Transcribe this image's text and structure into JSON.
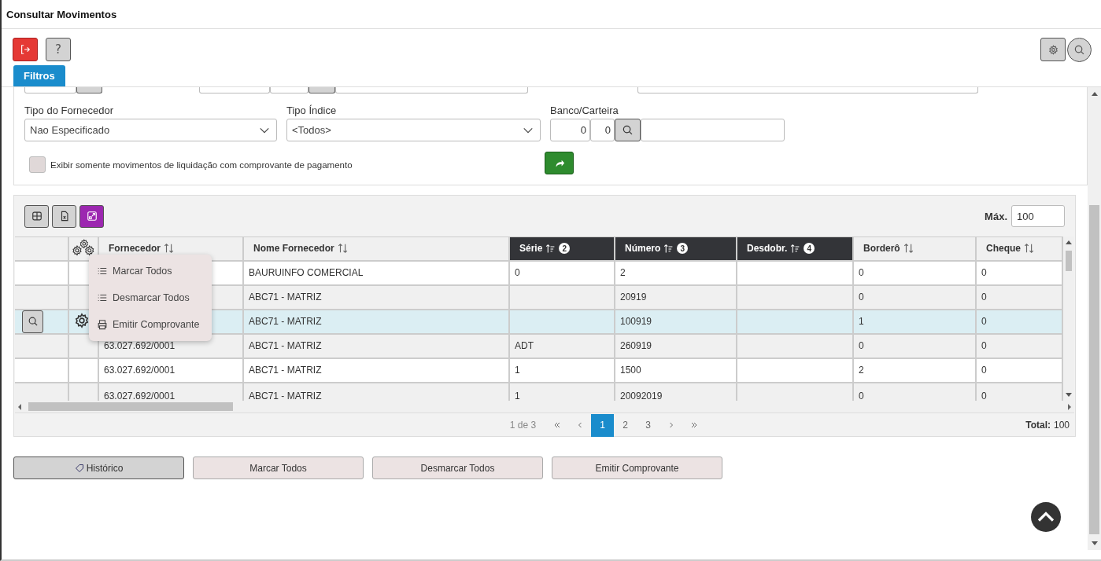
{
  "window": {
    "title": "Consultar Movimentos"
  },
  "toolbar": {
    "left": [
      {
        "kind": "exit"
      },
      {
        "kind": "help",
        "label": "?"
      }
    ],
    "right": [
      {
        "kind": "settings"
      },
      {
        "kind": "search"
      }
    ]
  },
  "tabs": [
    {
      "label": "Filtros",
      "selected": true
    }
  ],
  "filters": {
    "fields": [
      {
        "label": "Tipo do Fornecedor",
        "value": "Nao Especificado",
        "kind": "select"
      },
      {
        "label": "Tipo Índice",
        "value": "<Todos>",
        "kind": "select"
      }
    ],
    "bank": {
      "label": "Banco/Carteira",
      "bank": "0",
      "wallet": "0"
    },
    "checkbox": {
      "label": "Exibir somente movimentos de liquidação com comprovante de pagamento",
      "checked": false
    }
  },
  "grid": {
    "max_label": "Máx.",
    "max_value": "100",
    "columns": [
      {
        "label": "Fornecedor",
        "sorted": false
      },
      {
        "label": "Nome Fornecedor",
        "sorted": false
      },
      {
        "label": "Série",
        "sorted": true,
        "order": "2"
      },
      {
        "label": "Número",
        "sorted": true,
        "order": "3"
      },
      {
        "label": "Desdobr.",
        "sorted": true,
        "order": "4"
      },
      {
        "label": "Borderô",
        "sorted": false
      },
      {
        "label": "Cheque",
        "sorted": false
      }
    ],
    "rows": [
      {
        "selected": false,
        "cells": [
          null,
          "BAURUINFO COMERCIAL",
          "0",
          "2",
          "",
          "0",
          "0"
        ]
      },
      {
        "selected": false,
        "cells": [
          null,
          "ABC71 - MATRIZ",
          "",
          "20919",
          "",
          "0",
          "0"
        ]
      },
      {
        "selected": true,
        "cells": [
          null,
          "ABC71 - MATRIZ",
          "",
          "100919",
          "",
          "1",
          "0"
        ]
      },
      {
        "selected": false,
        "cells": [
          "63.027.692/0001",
          "ABC71 - MATRIZ",
          "ADT",
          "260919",
          "",
          "0",
          "0"
        ]
      },
      {
        "selected": false,
        "cells": [
          "63.027.692/0001",
          "ABC71 - MATRIZ",
          "1",
          "1500",
          "",
          "2",
          "0"
        ]
      },
      {
        "selected": false,
        "cells": [
          "63.027.692/0001",
          "ABC71 - MATRIZ",
          "1",
          "20092019",
          "",
          "0",
          "0"
        ]
      }
    ],
    "context_menu": [
      {
        "label": "Marcar Todos",
        "kind": "list"
      },
      {
        "label": "Desmarcar Todos",
        "kind": "list"
      },
      {
        "label": "Emitir Comprovante",
        "kind": "print"
      }
    ],
    "pagination": {
      "info": "1 de 3",
      "pages": [
        {
          "label": "1",
          "selected": true
        },
        {
          "label": "2",
          "selected": false
        },
        {
          "label": "3",
          "selected": false
        }
      ]
    },
    "total_label": "Total:",
    "total": "100"
  },
  "buttons": [
    {
      "label": "Histórico",
      "kind": "history"
    },
    {
      "label": "Marcar Todos",
      "kind": "plain"
    },
    {
      "label": "Desmarcar Todos",
      "kind": "plain"
    },
    {
      "label": "Emitir Comprovante",
      "kind": "plain"
    }
  ]
}
